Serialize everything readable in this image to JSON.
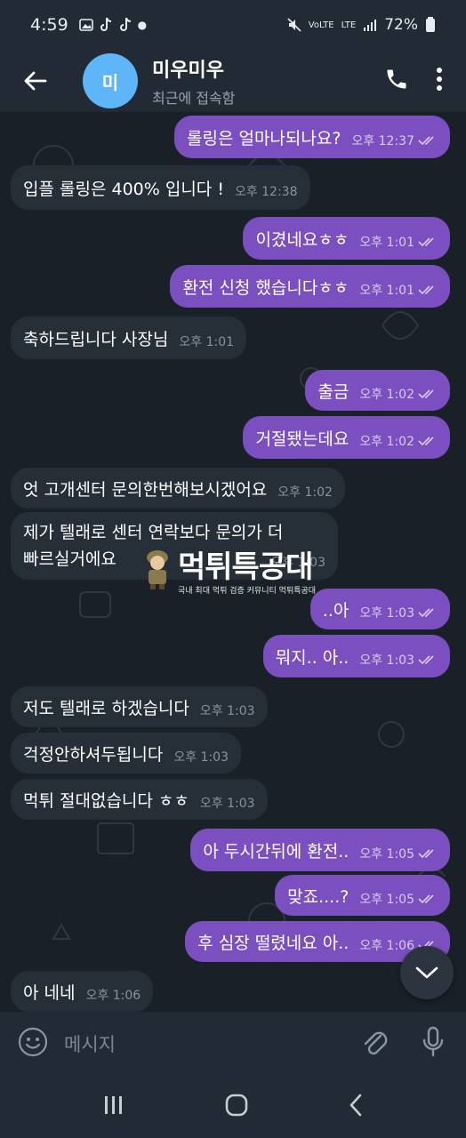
{
  "status_bar": {
    "time": "4:59",
    "network": "LTE",
    "battery": "72%"
  },
  "header": {
    "avatar_letter": "미",
    "title": "미우미우",
    "subtitle": "최근에 접속함"
  },
  "messages": [
    {
      "dir": "out",
      "text": "롤링은 얼마나되나요?",
      "time": "오후 12:37",
      "read": true
    },
    {
      "dir": "in",
      "text": "입플 롤링은 400% 입니다 !",
      "time": "오후 12:38"
    },
    {
      "dir": "out",
      "text": "이겼네요ㅎㅎ",
      "time": "오후 1:01",
      "read": true
    },
    {
      "dir": "out",
      "text": "환전 신청 했습니다ㅎㅎ",
      "time": "오후 1:01",
      "read": true
    },
    {
      "dir": "in",
      "text": "축하드립니다 사장님",
      "time": "오후 1:01"
    },
    {
      "dir": "out",
      "text": "출금",
      "time": "오후 1:02",
      "read": true
    },
    {
      "dir": "out",
      "text": "거절됐는데요",
      "time": "오후 1:02",
      "read": true
    },
    {
      "dir": "in",
      "text": "엇 고개센터 문의한번해보시겠어요",
      "time": "오후 1:02"
    },
    {
      "dir": "in",
      "line1": "제가 텔래로 센터 연락보다 문의가 더",
      "line2": "빠르실거에요",
      "time": "오후 1:03"
    },
    {
      "dir": "out",
      "text": "..아",
      "time": "오후 1:03",
      "read": true
    },
    {
      "dir": "out",
      "text": "뭐지.. 아..",
      "time": "오후 1:03",
      "read": true
    },
    {
      "dir": "in",
      "text": "저도 텔래로 하겠습니다",
      "time": "오후 1:03"
    },
    {
      "dir": "in",
      "text": "걱정안하셔두됩니다",
      "time": "오후 1:03"
    },
    {
      "dir": "in",
      "text": "먹튀 절대없습니다 ㅎㅎ",
      "time": "오후 1:03"
    },
    {
      "dir": "out",
      "text": "아 두시간뒤에 환전..",
      "time": "오후 1:05",
      "read": true
    },
    {
      "dir": "out",
      "text": "맞죠....?",
      "time": "오후 1:05",
      "read": true
    },
    {
      "dir": "out",
      "text": "후 심장 떨렸네요 아..",
      "time": "오후 1:06",
      "read": true
    },
    {
      "dir": "in",
      "text": "아 네네",
      "time": "오후 1:06"
    }
  ],
  "watermark": {
    "title": "먹튀특공대",
    "subtitle": "국내 최대 먹튀 검증 커뮤니티 먹튀특공대"
  },
  "input": {
    "placeholder": "메시지"
  },
  "icons": {
    "back": "arrow-left-icon",
    "call": "phone-icon",
    "menu": "more-vertical-icon",
    "emoji": "emoji-icon",
    "attach": "paperclip-icon",
    "mic": "microphone-icon",
    "scroll_down": "chevron-down-icon",
    "read_receipt": "double-check-icon"
  },
  "colors": {
    "outgoing_bubble": "#7b4fc0",
    "incoming_bubble": "#262e38",
    "header_bg": "#222b35",
    "chat_bg": "#1a2028",
    "avatar": "#5eb5f7"
  }
}
